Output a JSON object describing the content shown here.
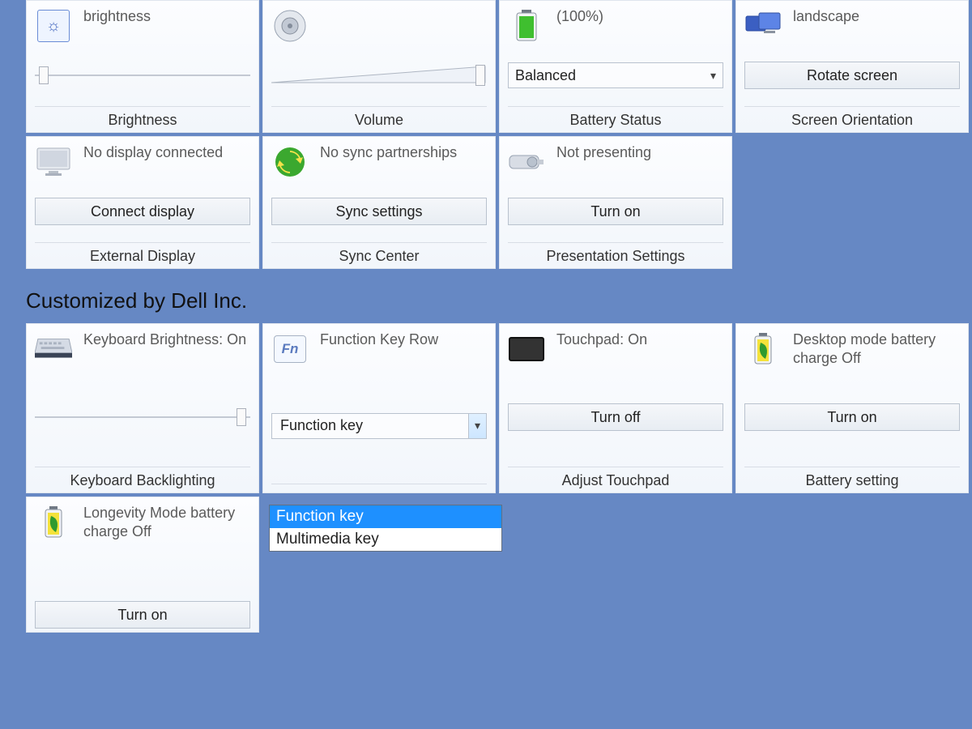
{
  "row1": {
    "brightness": {
      "status": "brightness",
      "label": "Brightness"
    },
    "volume": {
      "status": "",
      "label": "Volume"
    },
    "battery": {
      "status": "(100%)",
      "select": "Balanced",
      "label": "Battery Status"
    },
    "screen": {
      "status": "landscape",
      "button": "Rotate screen",
      "label": "Screen Orientation"
    }
  },
  "row2": {
    "external": {
      "status": "No display connected",
      "button": "Connect display",
      "label": "External Display"
    },
    "sync": {
      "status": "No sync partnerships",
      "button": "Sync settings",
      "label": "Sync Center"
    },
    "presentation": {
      "status": "Not presenting",
      "button": "Turn on",
      "label": "Presentation Settings"
    }
  },
  "section_heading": "Customized by Dell Inc.",
  "row3": {
    "keyboard": {
      "status": "Keyboard Brightness: On",
      "label": "Keyboard Backlighting"
    },
    "fn": {
      "status": "Function Key Row",
      "select": "Function key",
      "options": [
        "Function key",
        "Multimedia key"
      ],
      "label": ""
    },
    "touchpad": {
      "status": "Touchpad: On",
      "button": "Turn off",
      "label": "Adjust Touchpad"
    },
    "batt_desktop": {
      "status": "Desktop mode battery charge Off",
      "button": "Turn on",
      "label": "Battery setting"
    }
  },
  "row4": {
    "longevity": {
      "status": "Longevity Mode battery charge Off",
      "button": "Turn on"
    }
  },
  "fn_icon_text": "Fn"
}
